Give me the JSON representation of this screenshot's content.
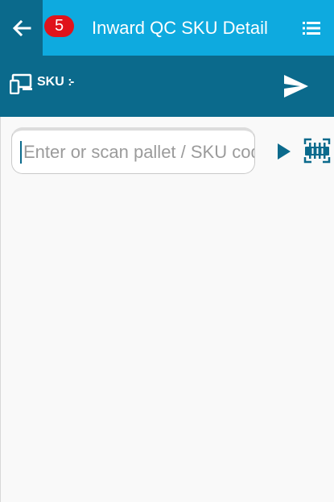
{
  "header": {
    "badge_count": "5",
    "title": "Inward QC SKU Detail",
    "icons": {
      "back": "back-arrow-icon",
      "menu": "list-menu-icon"
    }
  },
  "sku_bar": {
    "label": "SKU :",
    "value": "-",
    "icons": {
      "device": "devices-icon",
      "send": "send-icon"
    }
  },
  "scan": {
    "placeholder": "Enter or scan pallet / SKU code",
    "value": "",
    "icons": {
      "go": "play-arrow-icon",
      "barcode": "barcode-scan-icon"
    }
  },
  "colors": {
    "appbar": "#0eaadf",
    "dark_bar": "#0b6a8c",
    "badge": "#e0131b",
    "content_bg": "#f9f9f9"
  }
}
